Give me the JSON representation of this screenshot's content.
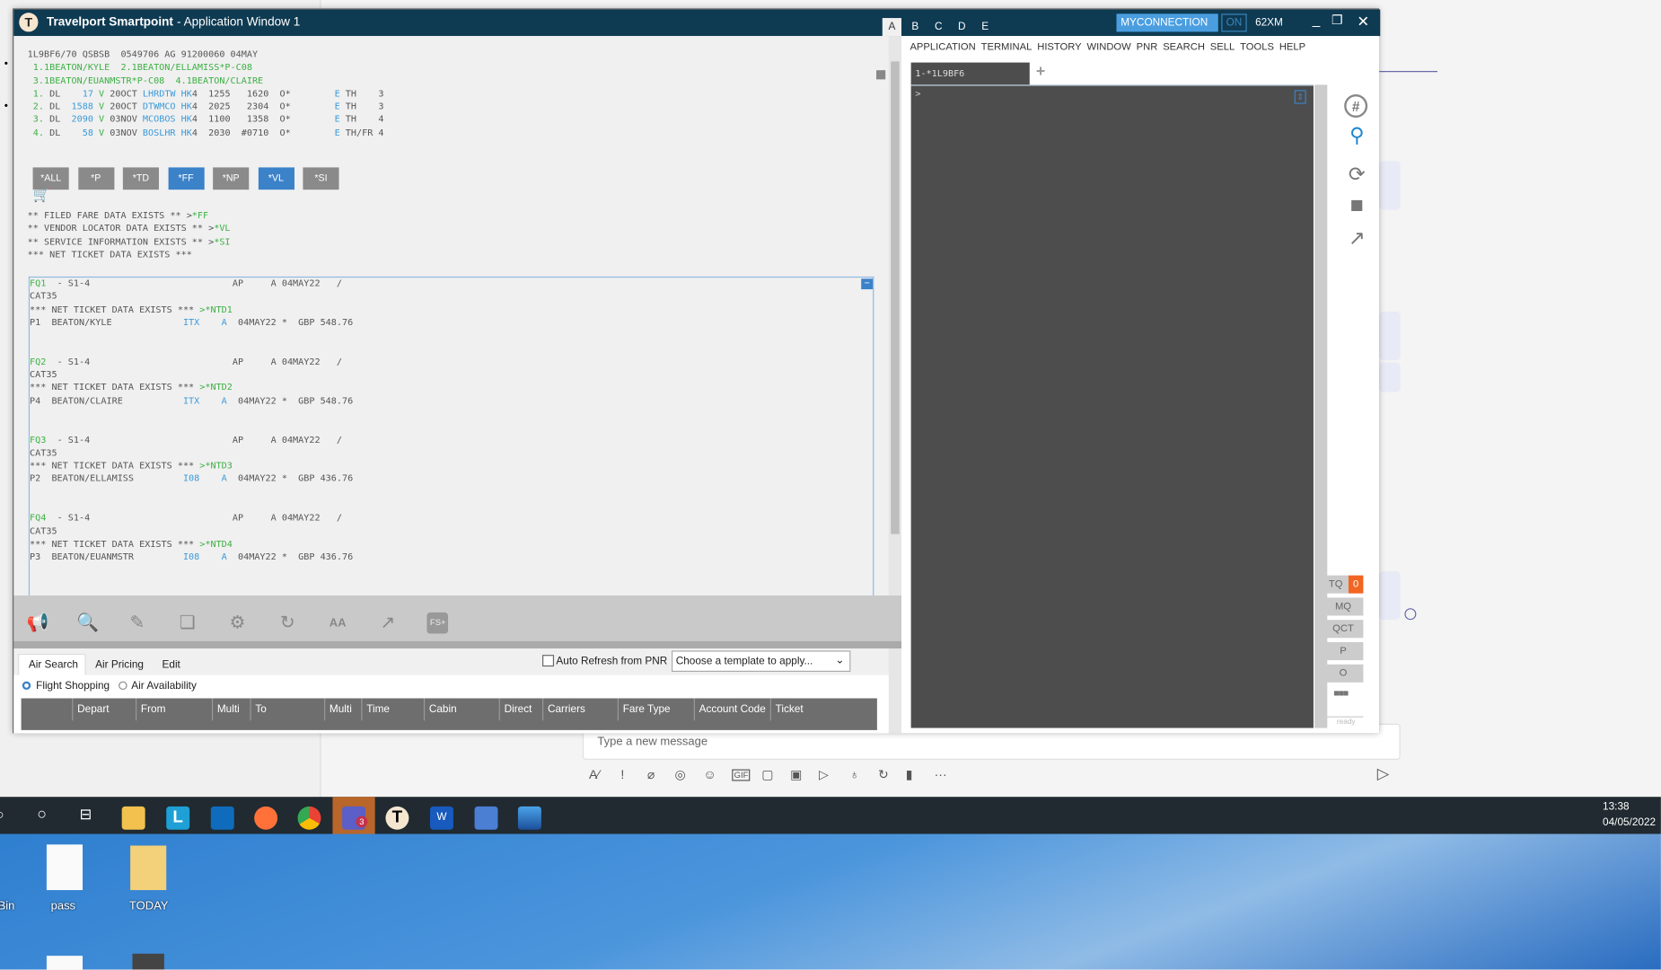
{
  "window": {
    "title_app": "Travelport Smartpoint",
    "title_rest": " - Application Window 1",
    "tabs": [
      "A",
      "B",
      "C",
      "D",
      "E"
    ],
    "connection": "MYCONNECTION",
    "on_label": "ON",
    "pcc": "62XM"
  },
  "terminal_lines": [
    [
      [
        "k",
        "1L9BF6/70 QSBSB  0549706 AG 91200060 04MAY"
      ]
    ],
    [
      [
        "g",
        " 1.1BEATON/KYLE  2.1BEATON/ELLAMISS*P-C08"
      ]
    ],
    [
      [
        "g",
        " 3.1BEATON/EUANMSTR*P-C08  4.1BEATON/CLAIRE"
      ]
    ],
    [
      [
        "g",
        " 1. "
      ],
      [
        "k",
        "DL  "
      ],
      [
        "b",
        "  17"
      ],
      [
        "g",
        " V "
      ],
      [
        "k",
        "20OCT "
      ],
      [
        "b",
        "LHRDTW HK"
      ],
      [
        "k",
        "4  1255   1620  O*        "
      ],
      [
        "b",
        "E"
      ],
      [
        "k",
        " TH    3"
      ]
    ],
    [
      [
        "g",
        " 2. "
      ],
      [
        "k",
        "DL  "
      ],
      [
        "b",
        "1588"
      ],
      [
        "g",
        " V "
      ],
      [
        "k",
        "20OCT "
      ],
      [
        "b",
        "DTWMCO HK"
      ],
      [
        "k",
        "4  2025   2304  O*        "
      ],
      [
        "b",
        "E"
      ],
      [
        "k",
        " TH    3"
      ]
    ],
    [
      [
        "g",
        " 3. "
      ],
      [
        "k",
        "DL  "
      ],
      [
        "b",
        "2090"
      ],
      [
        "g",
        " V "
      ],
      [
        "k",
        "03NOV "
      ],
      [
        "b",
        "MCOBOS HK"
      ],
      [
        "k",
        "4  1100   1358  O*        "
      ],
      [
        "b",
        "E"
      ],
      [
        "k",
        " TH    4"
      ]
    ],
    [
      [
        "g",
        " 4. "
      ],
      [
        "k",
        "DL  "
      ],
      [
        "b",
        "  58"
      ],
      [
        "g",
        " V "
      ],
      [
        "k",
        "03NOV "
      ],
      [
        "b",
        "BOSLHR HK"
      ],
      [
        "k",
        "4  2030  #0710  O*        "
      ],
      [
        "b",
        "E"
      ],
      [
        "k",
        " TH/FR 4"
      ]
    ]
  ],
  "quick_buttons": [
    {
      "label": "*ALL",
      "active": false
    },
    {
      "label": "*P",
      "active": false
    },
    {
      "label": "*TD",
      "active": false
    },
    {
      "label": "*FF",
      "active": true
    },
    {
      "label": "*NP",
      "active": false
    },
    {
      "label": "*VL",
      "active": true
    },
    {
      "label": "*SI",
      "active": false
    }
  ],
  "notice_lines": [
    [
      [
        "k",
        "** FILED FARE DATA EXISTS ** >"
      ],
      [
        "g",
        "*FF"
      ]
    ],
    [
      [
        "k",
        "** VENDOR LOCATOR DATA EXISTS ** >"
      ],
      [
        "g",
        "*VL"
      ]
    ],
    [
      [
        "k",
        "** SERVICE INFORMATION EXISTS ** >"
      ],
      [
        "g",
        "*SI"
      ]
    ],
    [
      [
        "k",
        "*** NET TICKET DATA EXISTS ***"
      ]
    ]
  ],
  "fare_lines": [
    [
      [
        "g",
        "FQ1"
      ],
      [
        "k",
        "  - S1-4                          AP     A 04MAY22   /"
      ]
    ],
    [
      [
        "k",
        "CAT35"
      ]
    ],
    [
      [
        "k",
        "*** NET TICKET DATA EXISTS *** "
      ],
      [
        "g",
        ">*NTD1"
      ]
    ],
    [
      [
        "k",
        "P1  BEATON/KYLE             "
      ],
      [
        "b",
        "ITX    A"
      ],
      [
        "k",
        "  04MAY22 *  GBP 548.76"
      ]
    ],
    [
      [
        "k",
        " "
      ]
    ],
    [
      [
        "k",
        " "
      ]
    ],
    [
      [
        "g",
        "FQ2"
      ],
      [
        "k",
        "  - S1-4                          AP     A 04MAY22   /"
      ]
    ],
    [
      [
        "k",
        "CAT35"
      ]
    ],
    [
      [
        "k",
        "*** NET TICKET DATA EXISTS *** "
      ],
      [
        "g",
        ">*NTD2"
      ]
    ],
    [
      [
        "k",
        "P4  BEATON/CLAIRE           "
      ],
      [
        "b",
        "ITX    A"
      ],
      [
        "k",
        "  04MAY22 *  GBP 548.76"
      ]
    ],
    [
      [
        "k",
        " "
      ]
    ],
    [
      [
        "k",
        " "
      ]
    ],
    [
      [
        "g",
        "FQ3"
      ],
      [
        "k",
        "  - S1-4                          AP     A 04MAY22   /"
      ]
    ],
    [
      [
        "k",
        "CAT35"
      ]
    ],
    [
      [
        "k",
        "*** NET TICKET DATA EXISTS *** "
      ],
      [
        "g",
        ">*NTD3"
      ]
    ],
    [
      [
        "k",
        "P2  BEATON/ELLAMISS         "
      ],
      [
        "b",
        "I08    A"
      ],
      [
        "k",
        "  04MAY22 *  GBP 436.76"
      ]
    ],
    [
      [
        "k",
        " "
      ]
    ],
    [
      [
        "k",
        " "
      ]
    ],
    [
      [
        "g",
        "FQ4"
      ],
      [
        "k",
        "  - S1-4                          AP     A 04MAY22   /"
      ]
    ],
    [
      [
        "k",
        "CAT35"
      ]
    ],
    [
      [
        "k",
        "*** NET TICKET DATA EXISTS *** "
      ],
      [
        "g",
        ">*NTD4"
      ]
    ],
    [
      [
        "k",
        "P3  BEATON/EUANMSTR         "
      ],
      [
        "b",
        "I08    A"
      ],
      [
        "k",
        "  04MAY22 *  GBP 436.76"
      ]
    ]
  ],
  "toolbar_icons": [
    "megaphone-icon",
    "search-icon",
    "pencil-icon",
    "copy-icon",
    "gear-icon",
    "refresh-icon",
    "font-size-icon",
    "external-link-icon",
    "fs-plus-icon"
  ],
  "fs_label": "FS+",
  "font_label": "AA",
  "bottom": {
    "tabs": [
      "Air Search",
      "Air Pricing",
      "Edit"
    ],
    "auto_refresh": "Auto Refresh from PNR",
    "template_placeholder": "Choose a template to apply...",
    "radio_flight": "Flight Shopping",
    "radio_avail": "Air Availability",
    "columns": [
      "Depart",
      "From",
      "Multi",
      "To",
      "Multi",
      "Time",
      "Cabin",
      "Direct",
      "Carriers",
      "Fare Type",
      "Account Code",
      "Ticket"
    ]
  },
  "menu": [
    "APPLICATION",
    "TERMINAL",
    "HISTORY",
    "WINDOW",
    "PNR",
    "SEARCH",
    "SELL",
    "TOOLS",
    "HELP"
  ],
  "session_tab": "1-*1L9BF6",
  "add_tab": "+",
  "prompt": ">",
  "queue": {
    "tq": "TQ",
    "tq_count": "0",
    "mq": "MQ",
    "qct": "QCT",
    "p": "P",
    "o": "O",
    "status": "ready"
  },
  "teams": {
    "placeholder": "Type a new message",
    "more": "···"
  },
  "taskbar": {
    "time": "13:38",
    "date": "04/05/2022",
    "teams_badge": "3"
  },
  "desktop": {
    "icons": [
      "Bin",
      "pass",
      "TODAY"
    ]
  },
  "colors": {
    "titlebar": "#0e3a52",
    "accent": "#3b82c9",
    "badge": "#f26522"
  }
}
